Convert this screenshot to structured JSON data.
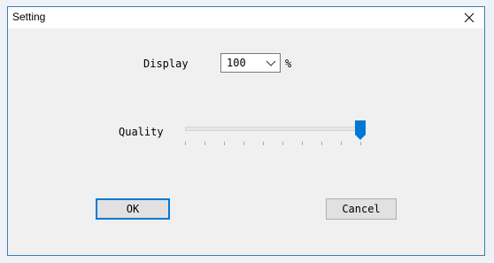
{
  "window": {
    "title": "Setting",
    "close_icon": "close-icon"
  },
  "display": {
    "label": "Display",
    "value": "100",
    "unit": "%",
    "arrow_icon": "chevron-down-icon"
  },
  "quality": {
    "label": "Quality",
    "level": 1.0,
    "tick_count": 10
  },
  "buttons": {
    "ok_label": "OK",
    "cancel_label": "Cancel"
  },
  "colors": {
    "accent": "#0078d7",
    "window_border": "#3c7fb1",
    "dialog_background": "#f0f0f0"
  }
}
